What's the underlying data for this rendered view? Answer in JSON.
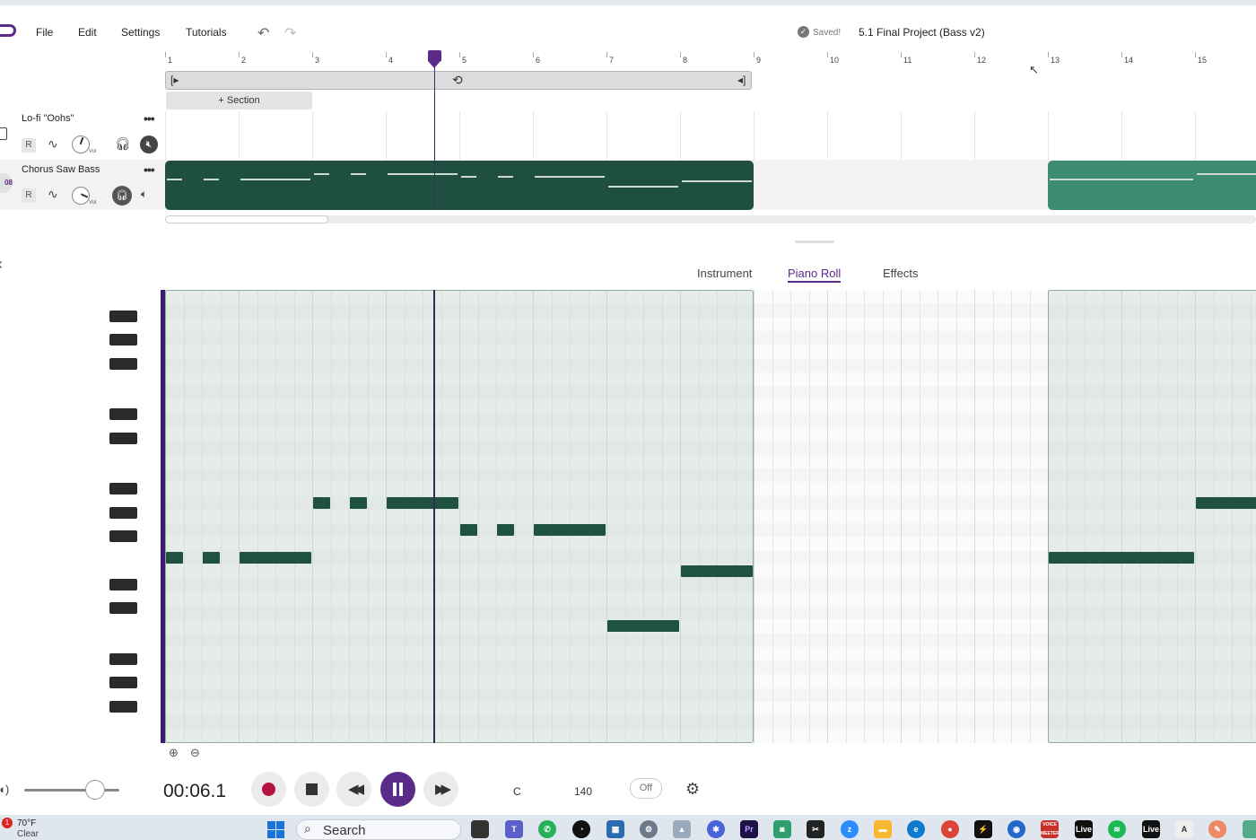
{
  "menu": {
    "items": [
      "File",
      "Edit",
      "Settings",
      "Tutorials"
    ],
    "undo_icon": "undo-icon",
    "redo_icon": "redo-icon",
    "saved_text": "Saved!",
    "project_title": "5.1 Final Project (Bass v2)"
  },
  "ruler": {
    "bars": [
      "1",
      "2",
      "3",
      "4",
      "5",
      "6",
      "7",
      "8",
      "9",
      "10",
      "11",
      "12",
      "13",
      "14",
      "15"
    ]
  },
  "arrange": {
    "section_button": "+ Section",
    "tracks": [
      {
        "name": "Lo-fi \"Oohs\"",
        "record_label": "R",
        "vol_label": "Vol",
        "solo_icon": "headphones-icon",
        "mute_icon": "mute-icon",
        "muted": true
      },
      {
        "name": "Chorus Saw Bass",
        "record_label": "R",
        "vol_label": "Vol",
        "solo_icon": "headphones-icon",
        "mute_icon": "mute-icon",
        "solo_active": true
      }
    ],
    "playhead_bar": 4.65
  },
  "tabs": {
    "items": [
      "Instrument",
      "Piano Roll",
      "Effects"
    ],
    "active": "Piano Roll"
  },
  "piano_roll": {
    "note_rows": 33,
    "notes": [
      {
        "start": 1.0,
        "len": 0.25,
        "row": 19
      },
      {
        "start": 1.5,
        "len": 0.25,
        "row": 19
      },
      {
        "start": 2.0,
        "len": 1.0,
        "row": 19
      },
      {
        "start": 3.0,
        "len": 0.25,
        "row": 15
      },
      {
        "start": 3.5,
        "len": 0.25,
        "row": 15
      },
      {
        "start": 4.0,
        "len": 1.0,
        "row": 15
      },
      {
        "start": 5.0,
        "len": 0.25,
        "row": 17
      },
      {
        "start": 5.5,
        "len": 0.25,
        "row": 17
      },
      {
        "start": 6.0,
        "len": 1.0,
        "row": 17
      },
      {
        "start": 7.0,
        "len": 1.0,
        "row": 24
      },
      {
        "start": 8.0,
        "len": 1.0,
        "row": 20
      },
      {
        "start": 13.0,
        "len": 2.0,
        "row": 19
      },
      {
        "start": 15.0,
        "len": 1.0,
        "row": 15
      }
    ],
    "clip_ranges": [
      [
        1,
        9
      ],
      [
        13,
        17
      ]
    ]
  },
  "transport": {
    "time": "00:06.1",
    "volume_fraction": 0.75,
    "key": "C",
    "bpm": "140",
    "metronome": "Off",
    "icons": [
      "speaker-icon",
      "record-icon",
      "stop-icon",
      "rewind-icon",
      "pause-icon",
      "fast-forward-icon",
      "settings-gear-icon"
    ]
  },
  "taskbar": {
    "weather_badge": "1",
    "temperature": "70°F",
    "condition": "Clear",
    "search_placeholder": "Search",
    "voicemeeter_label": "VOICE MEETER",
    "live_label": "Live",
    "live2_label": "Live"
  },
  "colors": {
    "accent": "#5b2b8a",
    "clip_dark": "#1e4f3f",
    "clip_light": "#3e8c6f",
    "note": "#1f5241",
    "record": "#b3133d"
  }
}
